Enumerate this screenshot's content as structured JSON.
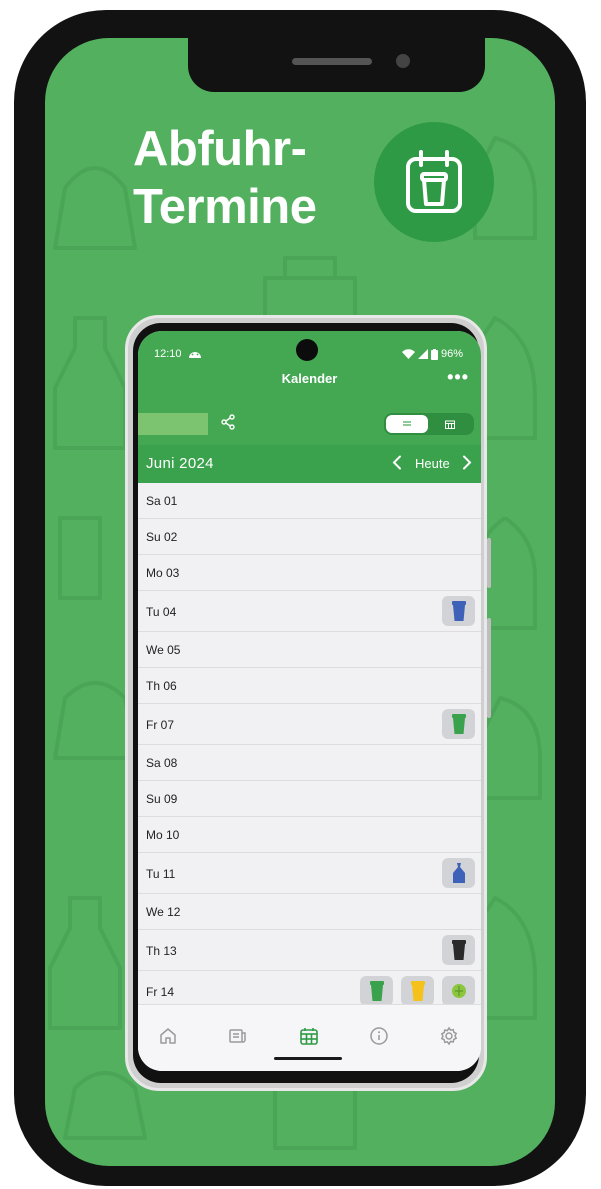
{
  "promo": {
    "headline_line1": "Abfuhr-",
    "headline_line2": "Termine",
    "badge_icon": "calendar-trash-icon"
  },
  "status_bar": {
    "time": "12:10",
    "battery": "96%"
  },
  "app": {
    "title": "Kalender",
    "more_icon": "more-dots-icon",
    "view_toggle": {
      "list_icon": "list-view-icon",
      "calendar_icon": "calendar-view-icon",
      "selected": "list"
    }
  },
  "calendar": {
    "month_label": "Juni  2024",
    "today_label": "Heute",
    "days": [
      {
        "label": "Sa 01",
        "pickups": []
      },
      {
        "label": "Su 02",
        "pickups": []
      },
      {
        "label": "Mo 03",
        "pickups": []
      },
      {
        "label": "Tu 04",
        "pickups": [
          "blue-bin-icon"
        ]
      },
      {
        "label": "We 05",
        "pickups": []
      },
      {
        "label": "Th 06",
        "pickups": []
      },
      {
        "label": "Fr 07",
        "pickups": [
          "green-bin-icon"
        ]
      },
      {
        "label": "Sa 08",
        "pickups": []
      },
      {
        "label": "Su 09",
        "pickups": []
      },
      {
        "label": "Mo 10",
        "pickups": []
      },
      {
        "label": "Tu 11",
        "pickups": [
          "blue-bag-icon"
        ]
      },
      {
        "label": "We 12",
        "pickups": []
      },
      {
        "label": "Th 13",
        "pickups": [
          "black-bin-icon"
        ]
      },
      {
        "label": "Fr 14",
        "pickups": [
          "green-bin-icon",
          "yellow-bin-icon",
          "organic-icon"
        ]
      }
    ]
  },
  "bottom_nav": [
    {
      "icon": "home-icon",
      "active": false
    },
    {
      "icon": "news-icon",
      "active": false
    },
    {
      "icon": "calendar-icon",
      "active": true
    },
    {
      "icon": "info-icon",
      "active": false
    },
    {
      "icon": "settings-icon",
      "active": false
    }
  ],
  "colors": {
    "background": "#52b05e",
    "app_bar": "#44a853",
    "accent": "#2e9b44",
    "bin_blue": "#3e62b8",
    "bin_green": "#3aa24c",
    "bin_black": "#2a2a2a",
    "bin_yellow": "#f4c21a"
  }
}
